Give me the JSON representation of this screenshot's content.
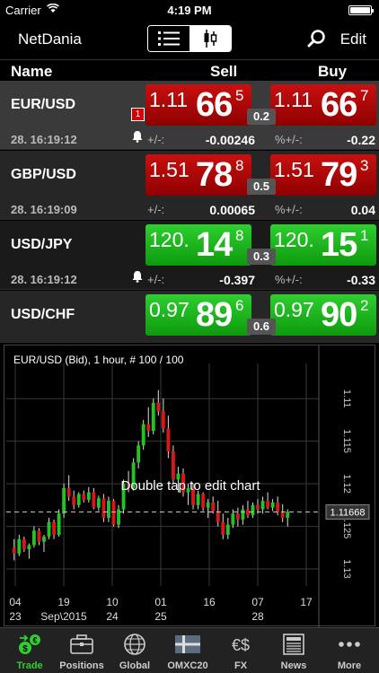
{
  "status": {
    "carrier": "Carrier",
    "time": "4:19 PM"
  },
  "nav": {
    "title": "NetDania",
    "edit": "Edit"
  },
  "table": {
    "headers": {
      "name": "Name",
      "sell": "Sell",
      "buy": "Buy"
    },
    "rows": [
      {
        "symbol": "EUR/USD",
        "time": "28. 16:19:12",
        "alert_count": "1",
        "sell": {
          "small": "1.11",
          "big": "66",
          "sup": "5"
        },
        "buy": {
          "small": "1.11",
          "big": "66",
          "sup": "7"
        },
        "spread": "0.2",
        "chg_label": "+/-:",
        "chg": "-0.00246",
        "pct_label": "%+/-:",
        "pct": "-0.22"
      },
      {
        "symbol": "GBP/USD",
        "time": "28. 16:19:09",
        "sell": {
          "small": "1.51",
          "big": "78",
          "sup": "8"
        },
        "buy": {
          "small": "1.51",
          "big": "79",
          "sup": "3"
        },
        "spread": "0.5",
        "chg_label": "+/-:",
        "chg": "0.00065",
        "pct_label": "%+/-:",
        "pct": "0.04"
      },
      {
        "symbol": "USD/JPY",
        "time": "28. 16:19:12",
        "sell": {
          "small": "120.",
          "big": "14",
          "sup": "8"
        },
        "buy": {
          "small": "120.",
          "big": "15",
          "sup": "1"
        },
        "spread": "0.3",
        "chg_label": "+/-:",
        "chg": "-0.397",
        "pct_label": "%+/-:",
        "pct": "-0.33"
      },
      {
        "symbol": "USD/CHF",
        "sell": {
          "small": "0.97",
          "big": "89",
          "sup": "6"
        },
        "buy": {
          "small": "0.97",
          "big": "90",
          "sup": "2"
        },
        "spread": "0.6"
      }
    ]
  },
  "chart": {
    "title": "EUR/USD (Bid), 1 hour, # 100 / 100",
    "hint": "Double tap to edit chart",
    "last_price": "1.11668",
    "y_ticks": [
      "1.13",
      "1.125",
      "1.12",
      "1.115",
      "1.11"
    ],
    "x_days": [
      "04",
      "19",
      "10",
      "01",
      "16",
      "07",
      "17"
    ],
    "x_sub": [
      "23",
      "Sep\\2015",
      "24",
      "25",
      "28"
    ]
  },
  "chart_data": {
    "type": "candlestick",
    "title": "EUR/USD (Bid), 1 hour, # 100 / 100",
    "ylim": [
      1.108,
      1.1335
    ],
    "y_ticks": [
      1.11,
      1.115,
      1.12,
      1.125,
      1.13
    ],
    "x_ticks": [
      "04 23",
      "19 Sep\\2015",
      "10 24",
      "01 25",
      "16",
      "07 28",
      "17"
    ],
    "last": 1.11668,
    "ohlc": [
      [
        1.1125,
        1.1135,
        1.111,
        1.1118
      ],
      [
        1.1118,
        1.114,
        1.1115,
        1.1135
      ],
      [
        1.1135,
        1.1138,
        1.112,
        1.1123
      ],
      [
        1.1123,
        1.113,
        1.1112,
        1.1128
      ],
      [
        1.1128,
        1.115,
        1.1125,
        1.1145
      ],
      [
        1.1145,
        1.1148,
        1.1128,
        1.1132
      ],
      [
        1.1132,
        1.114,
        1.112,
        1.1138
      ],
      [
        1.1138,
        1.116,
        1.1135,
        1.1155
      ],
      [
        1.1155,
        1.1158,
        1.1135,
        1.114
      ],
      [
        1.114,
        1.117,
        1.1138,
        1.1165
      ],
      [
        1.1165,
        1.12,
        1.116,
        1.1195
      ],
      [
        1.1195,
        1.121,
        1.118,
        1.1185
      ],
      [
        1.1185,
        1.1192,
        1.117,
        1.1175
      ],
      [
        1.1175,
        1.119,
        1.1172,
        1.1188
      ],
      [
        1.1188,
        1.1192,
        1.1178,
        1.1181
      ],
      [
        1.1181,
        1.1196,
        1.1178,
        1.119
      ],
      [
        1.119,
        1.1195,
        1.117,
        1.1172
      ],
      [
        1.1172,
        1.1186,
        1.1168,
        1.1183
      ],
      [
        1.1183,
        1.1188,
        1.1155,
        1.116
      ],
      [
        1.116,
        1.1185,
        1.1155,
        1.118
      ],
      [
        1.118,
        1.1182,
        1.115,
        1.1152
      ],
      [
        1.1152,
        1.1175,
        1.1148,
        1.117
      ],
      [
        1.117,
        1.1205,
        1.1165,
        1.12
      ],
      [
        1.12,
        1.1215,
        1.119,
        1.1195
      ],
      [
        1.1195,
        1.123,
        1.1192,
        1.1225
      ],
      [
        1.1225,
        1.125,
        1.1218,
        1.1245
      ],
      [
        1.1245,
        1.1275,
        1.124,
        1.127
      ],
      [
        1.127,
        1.129,
        1.1255,
        1.1262
      ],
      [
        1.1262,
        1.13,
        1.1258,
        1.1295
      ],
      [
        1.1295,
        1.131,
        1.128,
        1.1285
      ],
      [
        1.1285,
        1.13,
        1.126,
        1.1265
      ],
      [
        1.1265,
        1.128,
        1.123,
        1.1238
      ],
      [
        1.1238,
        1.1245,
        1.12,
        1.1205
      ],
      [
        1.1205,
        1.122,
        1.119,
        1.1212
      ],
      [
        1.1212,
        1.1218,
        1.1185,
        1.119
      ],
      [
        1.119,
        1.12,
        1.1175,
        1.1195
      ],
      [
        1.1195,
        1.12,
        1.117,
        1.1175
      ],
      [
        1.1175,
        1.1192,
        1.117,
        1.1188
      ],
      [
        1.1188,
        1.119,
        1.1168,
        1.1172
      ],
      [
        1.1172,
        1.1182,
        1.116,
        1.1178
      ],
      [
        1.1178,
        1.1185,
        1.1165,
        1.1168
      ],
      [
        1.1168,
        1.118,
        1.115,
        1.1155
      ],
      [
        1.1155,
        1.1165,
        1.1135,
        1.114
      ],
      [
        1.114,
        1.116,
        1.1135,
        1.1152
      ],
      [
        1.1152,
        1.117,
        1.1148,
        1.1165
      ],
      [
        1.1165,
        1.1172,
        1.115,
        1.1158
      ],
      [
        1.1158,
        1.1175,
        1.1152,
        1.117
      ],
      [
        1.117,
        1.118,
        1.116,
        1.1163
      ],
      [
        1.1163,
        1.1178,
        1.116,
        1.1175
      ],
      [
        1.1175,
        1.1182,
        1.1165,
        1.117
      ],
      [
        1.117,
        1.1185,
        1.1165,
        1.118
      ],
      [
        1.118,
        1.119,
        1.117,
        1.1172
      ],
      [
        1.1172,
        1.1182,
        1.1168,
        1.1178
      ],
      [
        1.1178,
        1.1185,
        1.1163,
        1.1166
      ],
      [
        1.1166,
        1.1176,
        1.1155,
        1.116
      ],
      [
        1.116,
        1.117,
        1.115,
        1.1167
      ]
    ]
  },
  "tabs": [
    {
      "label": "Trade",
      "icon": "trade-icon",
      "active": true
    },
    {
      "label": "Positions",
      "icon": "briefcase-icon"
    },
    {
      "label": "Global",
      "icon": "globe-icon"
    },
    {
      "label": "OMXC20",
      "icon": "flag-icon"
    },
    {
      "label": "FX",
      "icon": "currency-icon"
    },
    {
      "label": "News",
      "icon": "newspaper-icon"
    },
    {
      "label": "More",
      "icon": "more-icon"
    }
  ],
  "colors": {
    "sell_red": "#c81010",
    "buy_green": "#2fce2f",
    "active_tab": "#2fcf2f"
  }
}
